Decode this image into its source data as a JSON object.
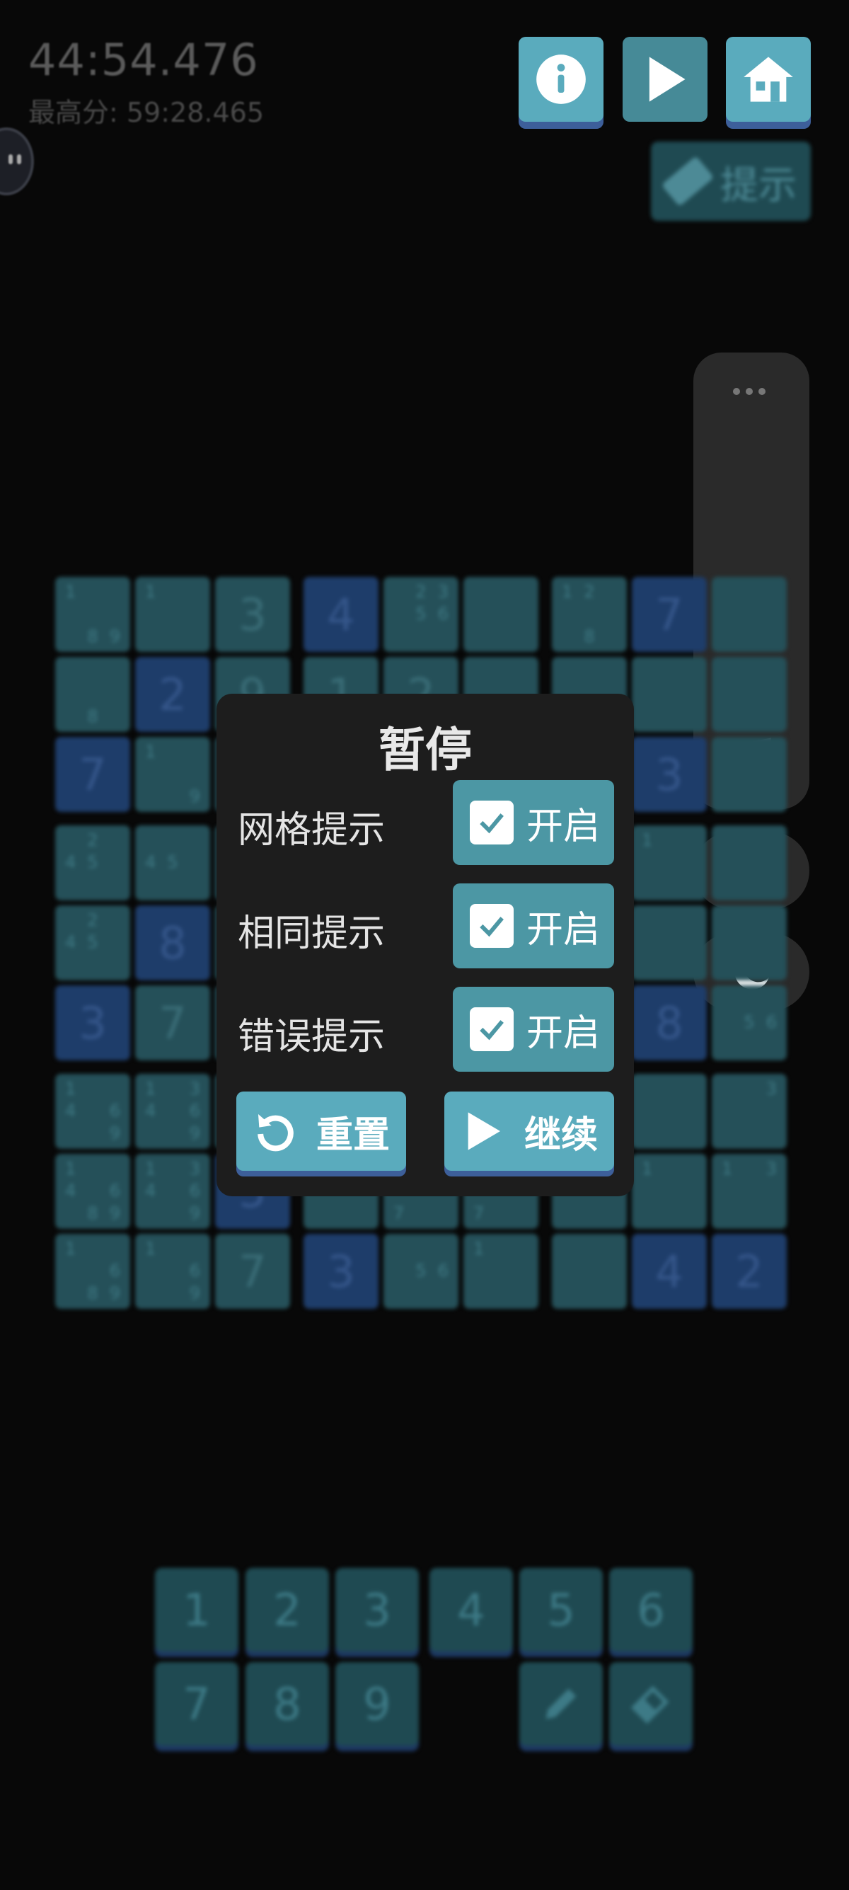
{
  "status": {
    "timer": "44:54.476",
    "best_score": "最高分: 59:28.465"
  },
  "toolbar": {
    "info_icon": "info-icon",
    "play_icon": "play-icon",
    "home_icon": "home-icon",
    "hint_label": "提示"
  },
  "grid": {
    "rows": [
      [
        {
          "notes": [
            "1",
            "",
            "",
            "",
            "",
            "",
            "",
            "8",
            "9"
          ]
        },
        {
          "notes": [
            "1",
            "",
            "",
            "",
            "",
            "",
            "",
            "",
            ""
          ]
        },
        {
          "value": "3"
        },
        {
          "value": "4",
          "given": true
        },
        {
          "notes": [
            "",
            "2",
            "3",
            "",
            "5",
            "6",
            "",
            "",
            ""
          ]
        },
        {},
        {
          "notes": [
            "1",
            "2",
            "",
            "",
            "",
            "",
            "",
            "8",
            ""
          ]
        },
        {
          "value": "7",
          "given": true
        },
        {}
      ],
      [
        {
          "notes": [
            "",
            "",
            "",
            "",
            "",
            "",
            "",
            "8",
            ""
          ]
        },
        {
          "value": "2",
          "given": true
        },
        {
          "value": "9"
        },
        {
          "value": "1"
        },
        {
          "value": "2"
        },
        {},
        {},
        {},
        {}
      ],
      [
        {
          "value": "7",
          "given": true
        },
        {
          "notes": [
            "1",
            "",
            "",
            "",
            "",
            "",
            "",
            "",
            "9"
          ]
        },
        {},
        {},
        {},
        {},
        {},
        {
          "value": "3",
          "given": true
        },
        {}
      ],
      [
        {
          "notes": [
            "",
            "2",
            "",
            "4",
            "5",
            "",
            "",
            "",
            ""
          ]
        },
        {
          "notes": [
            "",
            "",
            "",
            "4",
            "5",
            "",
            "",
            "",
            ""
          ]
        },
        {},
        {},
        {},
        {},
        {},
        {
          "notes": [
            "1",
            "",
            "",
            "",
            "",
            "",
            "",
            "",
            ""
          ]
        },
        {}
      ],
      [
        {
          "notes": [
            "",
            "2",
            "",
            "4",
            "5",
            "",
            "",
            "",
            ""
          ]
        },
        {
          "value": "8",
          "given": true
        },
        {},
        {},
        {},
        {},
        {},
        {},
        {}
      ],
      [
        {
          "value": "3",
          "given": true
        },
        {
          "value": "7"
        },
        {},
        {},
        {},
        {},
        {},
        {
          "value": "8",
          "given": true
        },
        {
          "notes": [
            "",
            "",
            "",
            "",
            "5",
            "6",
            "",
            "",
            ""
          ]
        }
      ],
      [
        {
          "notes": [
            "1",
            "",
            "",
            "4",
            "",
            "6",
            "",
            "",
            "9"
          ]
        },
        {
          "notes": [
            "1",
            "",
            "3",
            "4",
            "",
            "6",
            "",
            "",
            "9"
          ]
        },
        {},
        {},
        {},
        {},
        {},
        {},
        {
          "notes": [
            "",
            "",
            "3",
            "",
            "",
            "",
            "",
            "",
            ""
          ]
        }
      ],
      [
        {
          "notes": [
            "1",
            "",
            "",
            "4",
            "",
            "6",
            "",
            "8",
            "9"
          ]
        },
        {
          "notes": [
            "1",
            "",
            "3",
            "4",
            "",
            "6",
            "",
            "",
            "9"
          ]
        },
        {
          "value": "5",
          "given": true
        },
        {},
        {
          "notes": [
            "",
            "",
            "",
            "",
            "",
            "",
            "7",
            "",
            ""
          ]
        },
        {
          "notes": [
            "",
            "",
            "",
            "",
            "",
            "",
            "7",
            "",
            ""
          ]
        },
        {},
        {
          "notes": [
            "1",
            "",
            "",
            "",
            "",
            "",
            "",
            "",
            ""
          ]
        },
        {
          "notes": [
            "1",
            "",
            "3",
            "",
            "",
            "",
            "",
            "",
            ""
          ]
        }
      ],
      [
        {
          "notes": [
            "1",
            "",
            "",
            "",
            "",
            "6",
            "",
            "8",
            "9"
          ]
        },
        {
          "notes": [
            "1",
            "",
            "",
            "",
            "",
            "6",
            "",
            "",
            "9"
          ]
        },
        {
          "value": "7"
        },
        {
          "value": "3",
          "given": true
        },
        {
          "notes": [
            "",
            "",
            "",
            "",
            "5",
            "6",
            "",
            "",
            ""
          ]
        },
        {
          "notes": [
            "1",
            "",
            "",
            "",
            "",
            "",
            "",
            "",
            ""
          ]
        },
        {},
        {
          "value": "4",
          "given": true
        },
        {
          "value": "2",
          "given": true
        }
      ]
    ]
  },
  "numpad": {
    "keys": [
      "1",
      "2",
      "3",
      "4",
      "5",
      "6",
      "7",
      "8",
      "9"
    ],
    "pencil_icon": "pencil-icon",
    "eraser_icon": "eraser-icon"
  },
  "side_panel": {
    "music_icon": "music-off-icon",
    "bell_icon": "bell-icon",
    "moon_icon": "moon-icon"
  },
  "dialog": {
    "title": "暂停",
    "options": [
      {
        "label": "网格提示",
        "toggle": "开启",
        "checked": true
      },
      {
        "label": "相同提示",
        "toggle": "开启",
        "checked": true
      },
      {
        "label": "错误提示",
        "toggle": "开启",
        "checked": true
      }
    ],
    "reset_label": "重置",
    "continue_label": "继续"
  },
  "colors": {
    "accent": "#5aabbd",
    "accent_shadow": "#3d5f9a",
    "dialog_bg": "#1d1d1d"
  }
}
